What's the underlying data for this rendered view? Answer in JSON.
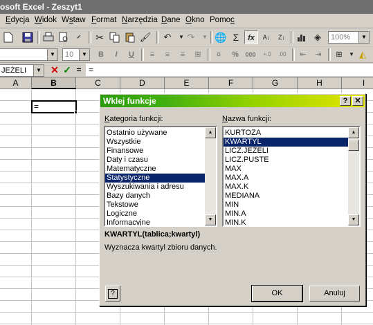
{
  "window": {
    "title": "osoft Excel - Zeszyt1"
  },
  "menu": {
    "items": [
      {
        "label": "Edycja",
        "key": "E",
        "rest": "dycja"
      },
      {
        "label": "Widok",
        "key": "W",
        "rest": "idok"
      },
      {
        "label": "Wstaw",
        "pre": "W",
        "key": "s",
        "rest": "taw"
      },
      {
        "label": "Format",
        "key": "F",
        "rest": "ormat"
      },
      {
        "label": "Narzędzia",
        "key": "N",
        "rest": "arzędzia"
      },
      {
        "label": "Dane",
        "key": "D",
        "rest": "ane"
      },
      {
        "label": "Okno",
        "key": "O",
        "rest": "kno"
      },
      {
        "label": "Pomoc",
        "pre": "Pomo",
        "key": "c",
        "rest": ""
      }
    ]
  },
  "toolbar": {
    "zoom": "100%",
    "font_size": "10",
    "bold": "B",
    "italic": "I",
    "underline": "U",
    "percent": "%",
    "thousands": "000",
    "sum": "Σ",
    "fx": "fx"
  },
  "formula_bar": {
    "name_box": "JEŻELI",
    "content": "="
  },
  "grid": {
    "columns": [
      "A",
      "B",
      "C",
      "D",
      "E",
      "F",
      "G",
      "H",
      "I"
    ],
    "active_column": "B",
    "active_cell_value": "="
  },
  "dialog": {
    "title": "Wklej funkcje",
    "help_button": "?",
    "close_button": "✕",
    "category_label": "Kategoria funkcji:",
    "name_label": "Nazwa funkcji:",
    "categories": [
      "Ostatnio używane",
      "Wszystkie",
      "Finansowe",
      "Daty i czasu",
      "Matematyczne",
      "Statystyczne",
      "Wyszukiwania i adresu",
      "Bazy danych",
      "Tekstowe",
      "Logiczne",
      "Informacyjne"
    ],
    "selected_category": "Statystyczne",
    "functions": [
      "KURTOZA",
      "KWARTYL",
      "LICZ.JEŻELI",
      "LICZ.PUSTE",
      "MAX",
      "MAX.A",
      "MAX.K",
      "MEDIANA",
      "MIN",
      "MIN.A",
      "MIN.K"
    ],
    "selected_function": "KWARTYL",
    "syntax": "KWARTYL(tablica;kwartyl)",
    "description": "Wyznacza kwartyl zbioru danych.",
    "ok_label": "OK",
    "cancel_label": "Anuluj",
    "help_icon_label": "?"
  }
}
